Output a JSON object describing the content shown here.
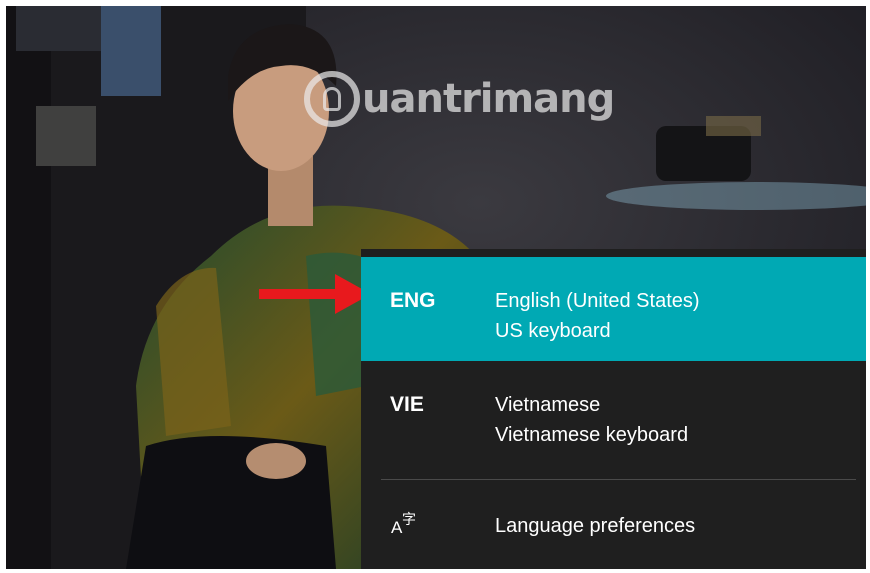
{
  "watermark": {
    "text": "uantrimang",
    "icon": "lightbulb-icon"
  },
  "annotation": {
    "arrow_color": "#e8191d",
    "icon": "arrow-right-icon"
  },
  "languages": [
    {
      "code": "ENG",
      "name": "English (United States)",
      "keyboard": "US keyboard",
      "selected": true
    },
    {
      "code": "VIE",
      "name": "Vietnamese",
      "keyboard": "Vietnamese keyboard",
      "selected": false
    }
  ],
  "preferences": {
    "label": "Language preferences",
    "icon": "language-preferences-icon",
    "icon_text": "A字"
  },
  "colors": {
    "accent": "#00a9b4",
    "flyout_bg": "#1f1f1f",
    "text": "#ffffff"
  }
}
